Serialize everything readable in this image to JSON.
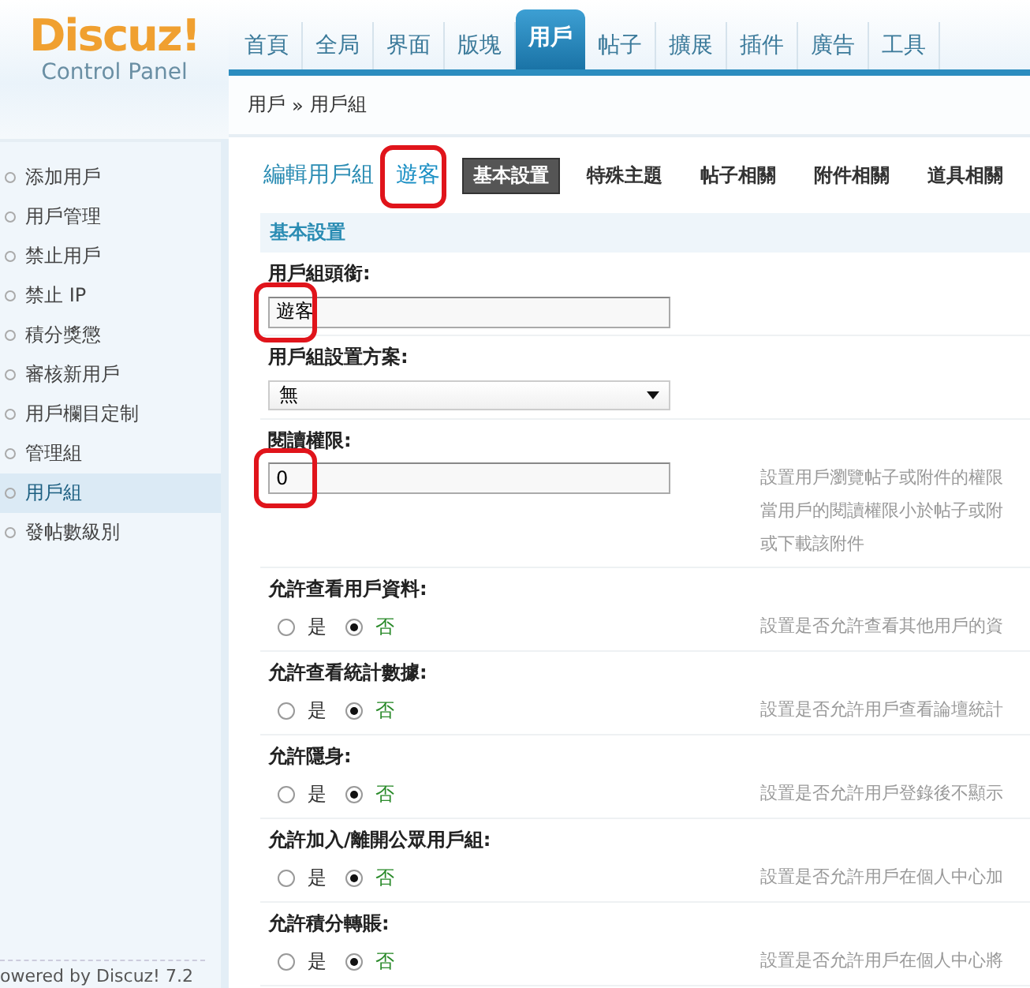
{
  "logo": {
    "title": "Discuz!",
    "subtitle": "Control Panel"
  },
  "nav": [
    {
      "label": "首頁",
      "selected": false
    },
    {
      "label": "全局",
      "selected": false
    },
    {
      "label": "界面",
      "selected": false
    },
    {
      "label": "版塊",
      "selected": false
    },
    {
      "label": "用戶",
      "selected": true
    },
    {
      "label": "帖子",
      "selected": false
    },
    {
      "label": "擴展",
      "selected": false
    },
    {
      "label": "插件",
      "selected": false
    },
    {
      "label": "廣告",
      "selected": false
    },
    {
      "label": "工具",
      "selected": false
    }
  ],
  "breadcrumb": {
    "items": [
      "用戶",
      "用戶組"
    ],
    "separator": "»"
  },
  "sidebar": {
    "items": [
      {
        "label": "添加用戶",
        "selected": false
      },
      {
        "label": "用戶管理",
        "selected": false
      },
      {
        "label": "禁止用戶",
        "selected": false
      },
      {
        "label": "禁止 IP",
        "selected": false
      },
      {
        "label": "積分獎懲",
        "selected": false
      },
      {
        "label": "審核新用戶",
        "selected": false
      },
      {
        "label": "用戶欄目定制",
        "selected": false
      },
      {
        "label": "管理組",
        "selected": false
      },
      {
        "label": "用戶組",
        "selected": true
      },
      {
        "label": "發帖數級別",
        "selected": false
      }
    ],
    "footer": "owered by Discuz! 7.2"
  },
  "subnav": {
    "title": "編輯用戶組",
    "group": {
      "label": "遊客",
      "annotated": true
    },
    "tabs": [
      {
        "label": "基本設置",
        "selected": true
      },
      {
        "label": "特殊主題",
        "selected": false
      },
      {
        "label": "帖子相關",
        "selected": false
      },
      {
        "label": "附件相關",
        "selected": false
      },
      {
        "label": "道具相關",
        "selected": false
      }
    ]
  },
  "section": {
    "title": "基本設置"
  },
  "fields": [
    {
      "kind": "text",
      "label": "用戶組頭銜:",
      "value": "遊客",
      "annotated": true
    },
    {
      "kind": "select",
      "label": "用戶組設置方案:",
      "value": "無"
    },
    {
      "kind": "text",
      "label": "閱讀權限:",
      "value": "0",
      "annotated": true,
      "description": [
        "設置用戶瀏覽帖子或附件的權限",
        "當用戶的閱讀權限小於帖子或附",
        "或下載該附件"
      ]
    },
    {
      "kind": "radio",
      "label": "允許查看用戶資料:",
      "options": [
        {
          "label": "是",
          "selected": false
        },
        {
          "label": "否",
          "selected": true
        }
      ],
      "description": [
        "設置是否允許查看其他用戶的資"
      ]
    },
    {
      "kind": "radio",
      "label": "允許查看統計數據:",
      "options": [
        {
          "label": "是",
          "selected": false
        },
        {
          "label": "否",
          "selected": true
        }
      ],
      "description": [
        "設置是否允許用戶查看論壇統計"
      ]
    },
    {
      "kind": "radio",
      "label": "允許隱身:",
      "options": [
        {
          "label": "是",
          "selected": false
        },
        {
          "label": "否",
          "selected": true
        }
      ],
      "description": [
        "設置是否允許用戶登錄後不顯示"
      ]
    },
    {
      "kind": "radio",
      "label": "允許加入/離開公眾用戶組:",
      "options": [
        {
          "label": "是",
          "selected": false
        },
        {
          "label": "否",
          "selected": true
        }
      ],
      "description": [
        "設置是否允許用戶在個人中心加"
      ]
    },
    {
      "kind": "radio",
      "label": "允許積分轉賬:",
      "options": [
        {
          "label": "是",
          "selected": false
        },
        {
          "label": "否",
          "selected": true
        }
      ],
      "description": [
        "設置是否允許用戶在個人中心將"
      ]
    }
  ]
}
